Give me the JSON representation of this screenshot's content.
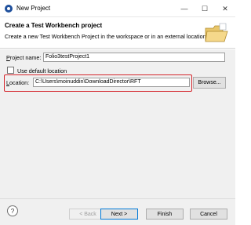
{
  "window": {
    "title": "New Project"
  },
  "header": {
    "title": "Create a Test Workbench project",
    "description": "Create a new Test Workbench Project in the workspace or in an external location."
  },
  "form": {
    "project_name_label_underlined": "P",
    "project_name_label_rest": "roject name:",
    "project_name_value": "Folio3testProject1",
    "default_location_label": "Use default location",
    "default_location_checked": false,
    "location_label_underlined": "L",
    "location_label_rest": "ocation:",
    "location_value": "C:\\Users\\moinuddin\\DownloadDirector\\RFT",
    "browse_label": "Browse..."
  },
  "footer": {
    "help_label": "?",
    "back_label": "< Back",
    "next_label": "Next >",
    "finish_label": "Finish",
    "cancel_label": "Cancel"
  },
  "colors": {
    "highlight": "#d4252b",
    "background": "#f0f0f0"
  }
}
